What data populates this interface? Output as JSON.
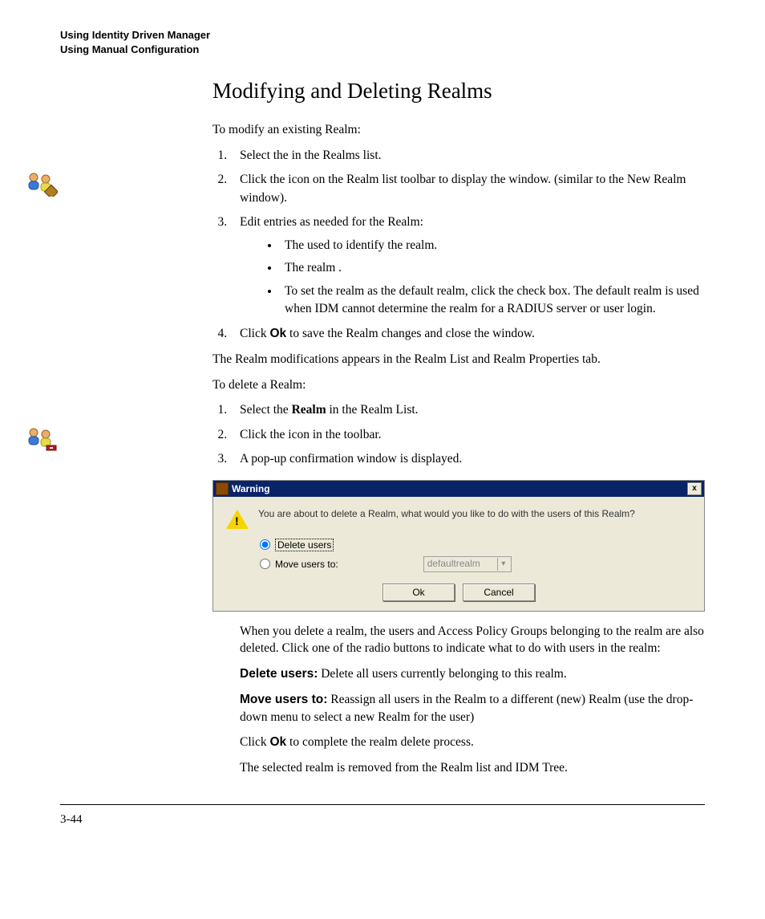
{
  "header": {
    "line1": "Using Identity Driven Manager",
    "line2": "Using Manual Configuration"
  },
  "title": "Modifying and Deleting Realms",
  "intro_modify": "To modify an existing Realm:",
  "modify_steps": {
    "s1a": "Select the ",
    "s1b": " in the Realms list.",
    "s2a": "Click the ",
    "s2b": " icon on the Realm list toolbar to display the ",
    "s2c": " window. (similar to the New Realm window).",
    "s3_lead": "Edit entries as needed for the Realm:",
    "b1a": "The ",
    "b1b": " used to identify the realm.",
    "b2a": "The realm ",
    "b2b": ".",
    "b3a": "To set the realm as the default realm, click the ",
    "b3b": " check box. The default realm is used when IDM cannot determine the realm for a RADIUS server or user login.",
    "s4a": "Click ",
    "s4_bold": "Ok",
    "s4b": " to save the Realm changes and close the window."
  },
  "after_modify": "The Realm modifications  appears in the Realm List and Realm Properties tab.",
  "intro_delete": "To delete a Realm:",
  "delete_steps": {
    "s1a": "Select the ",
    "s1_bold": "Realm",
    "s1b": " in the Realm List.",
    "s2a": "Click the ",
    "s2b": " icon in the toolbar.",
    "s3": "A pop-up confirmation window is displayed."
  },
  "dialog": {
    "title": "Warning",
    "close": "x",
    "message": "You are about to delete a Realm, what would you like to do with the users of this Realm?",
    "opt_delete": "Delete users",
    "opt_move": "Move users to:",
    "select_value": "defaultrealm",
    "ok": "Ok",
    "cancel": "Cancel"
  },
  "after_dialog": {
    "p1": "When you delete a realm, the users and Access Policy Groups belonging to the realm are also deleted. Click one of the radio buttons to indicate what to do with users in the realm:",
    "du_bold": "Delete users:",
    "du_text": " Delete all users currently belonging to this realm.",
    "mu_bold": "Move users to:",
    "mu_text": " Reassign all users in the Realm to a different (new) Realm (use the drop-down menu to select a new Realm for the user)",
    "ok_a": "Click ",
    "ok_bold": "Ok",
    "ok_b": " to complete the realm delete process.",
    "final": "The selected realm is removed from the Realm list and IDM Tree."
  },
  "page_number": "3-44"
}
